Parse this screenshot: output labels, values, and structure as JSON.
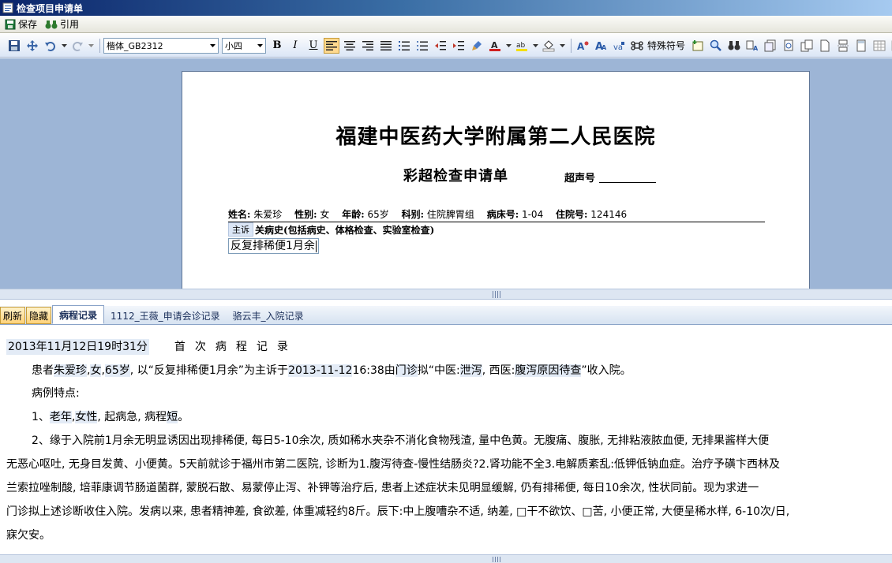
{
  "window": {
    "title": "检查项目申请单"
  },
  "menubar": {
    "save_label": "保存",
    "quote_label": "引用"
  },
  "toolbar": {
    "font_name": "楷体_GB2312",
    "font_size": "小四",
    "special_chars_label": "特殊符号"
  },
  "document": {
    "hospital": "福建中医药大学附属第二人民医院",
    "form_title": "彩超检查申请单",
    "ultrasound_no_label": "超声号",
    "patient": {
      "name_label": "姓名:",
      "name": "朱爱珍",
      "sex_label": "性别:",
      "sex": "女",
      "age_label": "年龄:",
      "age": "65岁",
      "dept_label": "科别:",
      "dept": "住院脾胃组",
      "bed_label": "病床号:",
      "bed": "1-04",
      "inpatient_label": "住院号:",
      "inpatient": "124146"
    },
    "tag_main": "主诉",
    "history_label": "关病史(包括病史、体格检查、实验室检查)",
    "complaint": "反复排稀便1月余"
  },
  "tabs": {
    "refresh": "刷新",
    "hide": "隐藏",
    "items": [
      "病程记录",
      "1112_王薇_申请会诊记录",
      "骆云丰_入院记录"
    ]
  },
  "record": {
    "datetime": "2013年11月12日19时31分",
    "title": "首次病程记录",
    "p1_a": "患者",
    "p1_name": "朱爱珍",
    "p1_b": ",",
    "p1_sex": "女",
    "p1_c": ",",
    "p1_age": "65岁",
    "p1_d": ", 以“反复排稀便1月余”为主诉于",
    "p1_date": "2013-11-12",
    "p1_e": "16:38由",
    "p1_from": "门诊",
    "p1_f": "拟“中医:",
    "p1_tcm": "泄泻",
    "p1_g": ", 西医:",
    "p1_wm": "腹泻原因待查",
    "p1_h": "”收入院。",
    "p2": "病例特点:",
    "p3_a": "1、",
    "p3_old": "老年",
    "p3_b": ",",
    "p3_female": "女性",
    "p3_c": ", 起病急, 病程",
    "p3_short": "短",
    "p3_d": "。",
    "p4": "2、缘于入院前1月余无明显诱因出现排稀便, 每日5-10余次, 质如稀水夹杂不消化食物残渣, 量中色黄。无腹痛、腹胀, 无排粘液脓血便, 无排果酱样大便",
    "p5": "无恶心呕吐, 无身目发黄、小便黄。5天前就诊于福州市第二医院, 诊断为1.腹泻待查-慢性结肠炎?2.肾功能不全3.电解质紊乱:低钾低钠血症。治疗予磺卞西林及",
    "p6": "兰索拉唑制酸, 培菲康调节肠道菌群, 蒙脱石散、易蒙停止泻、补钾等治疗后, 患者上述症状未见明显缓解, 仍有排稀便, 每日10余次, 性状同前。现为求进一",
    "p7": "门诊拟上述诊断收住入院。发病以来, 患者精神差, 食欲差, 体重减轻约8斤。辰下:中上腹嘈杂不适, 纳差, □干不欲饮、□苦, 小便正常, 大便呈稀水样, 6-10次/日,",
    "p8": "寐欠安。"
  },
  "colors": {
    "accent": "#ffd27a",
    "highlight": "#e3ebf6",
    "editor_bg": "#9db5d6"
  }
}
